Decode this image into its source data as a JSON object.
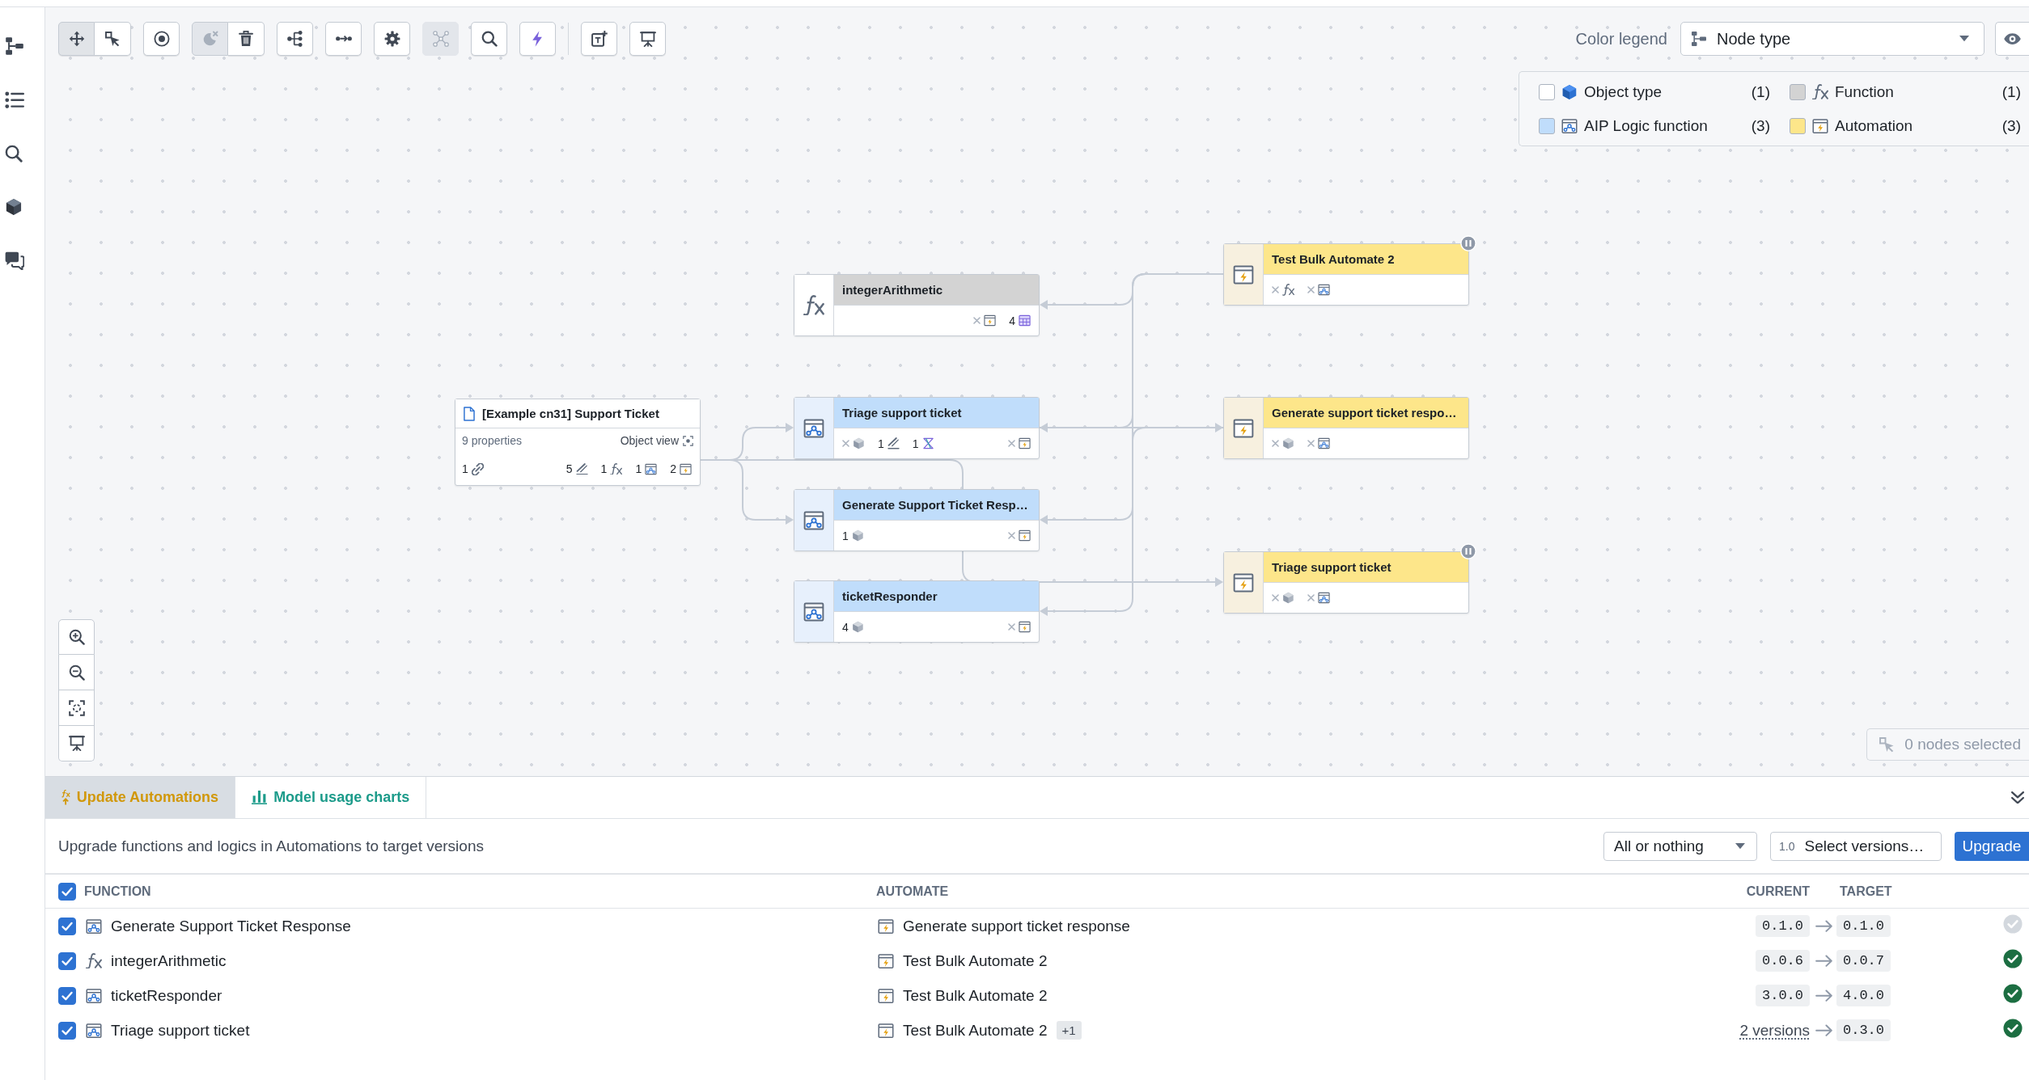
{
  "toolbar": {
    "modes": [
      {
        "kind": "pan",
        "selected": true
      },
      {
        "kind": "select",
        "selected": false
      }
    ],
    "actions": [
      [
        {
          "kind": "focus",
          "disabled": false
        }
      ],
      [
        {
          "kind": "hide",
          "disabled": true
        },
        {
          "kind": "delete",
          "disabled": false
        }
      ],
      [
        {
          "kind": "layout",
          "disabled": false
        }
      ],
      [
        {
          "kind": "path",
          "disabled": false
        }
      ],
      [
        {
          "kind": "settings",
          "disabled": false
        }
      ],
      [
        {
          "kind": "cluster",
          "disabled": true
        }
      ],
      [
        {
          "kind": "search",
          "disabled": false
        }
      ],
      [
        {
          "kind": "automate",
          "disabled": false
        }
      ]
    ],
    "insert": [
      {
        "kind": "text",
        "disabled": false
      },
      {
        "kind": "present",
        "disabled": false
      }
    ]
  },
  "color_legend": {
    "label": "Color legend",
    "value": "Node type",
    "items": [
      {
        "kind": "object",
        "label": "Object type",
        "count": "(1)",
        "color": "#ffffff"
      },
      {
        "kind": "function",
        "label": "Function",
        "count": "(1)",
        "color": "#d3d3d3"
      },
      {
        "kind": "logic",
        "label": "AIP Logic function",
        "count": "(3)",
        "color": "#c0ddfb"
      },
      {
        "kind": "automation",
        "label": "Automation",
        "count": "(3)",
        "color": "#fde68a"
      }
    ]
  },
  "graph": {
    "object_types": [
      {
        "title": "[Example cn31] Support Ticket",
        "subtitle": "9 properties",
        "action": "Object view",
        "start": [
          {
            "kind": "link",
            "count": "1"
          }
        ],
        "end": [
          {
            "kind": "property",
            "count": "5"
          },
          {
            "kind": "function",
            "count": "1"
          },
          {
            "kind": "logic",
            "count": "1"
          },
          {
            "kind": "automation",
            "count": "2"
          }
        ]
      }
    ],
    "functions": [
      {
        "kind": "function",
        "title": "integerArithmetic",
        "end": [
          {
            "kind": "automation"
          },
          {
            "kind": "module",
            "count": "4"
          }
        ]
      },
      {
        "kind": "logic",
        "title": "Triage support ticket",
        "start": [
          {
            "kind": "object"
          },
          {
            "kind": "property",
            "count": "1"
          },
          {
            "kind": "model",
            "count": "1"
          }
        ],
        "end": [
          {
            "kind": "automation"
          }
        ]
      },
      {
        "kind": "logic",
        "title": "Generate Support Ticket Resp…",
        "start": [
          {
            "kind": "object",
            "count": "1"
          }
        ],
        "end": [
          {
            "kind": "automation"
          }
        ]
      },
      {
        "kind": "logic",
        "title": "ticketResponder",
        "start": [
          {
            "kind": "object",
            "count": "4"
          }
        ],
        "end": [
          {
            "kind": "automation"
          }
        ]
      }
    ],
    "automations": [
      {
        "title": "Test Bulk Automate 2",
        "paused": true,
        "start": [
          {
            "kind": "function"
          },
          {
            "kind": "logic"
          }
        ]
      },
      {
        "title": "Generate support ticket respo…",
        "paused": false,
        "start": [
          {
            "kind": "object"
          },
          {
            "kind": "logic"
          }
        ]
      },
      {
        "title": "Triage support ticket",
        "paused": true,
        "start": [
          {
            "kind": "object"
          },
          {
            "kind": "logic"
          }
        ]
      }
    ]
  },
  "selection_status": "0 nodes selected",
  "bottom_panel": {
    "tabs": [
      {
        "kind": "upgrade",
        "label": "Update Automations",
        "selected": true
      },
      {
        "kind": "charts",
        "label": "Model usage charts",
        "selected": false
      }
    ],
    "description": "Upgrade functions and logics in Automations to target versions",
    "mode_select": "All or nothing",
    "versions_button": {
      "prefix": "1.0",
      "label": "Select versions…"
    },
    "upgrade_button": "Upgrade",
    "table": {
      "columns": [
        "FUNCTION",
        "AUTOMATE",
        "CURRENT",
        "TARGET"
      ],
      "all_checked": true,
      "rows": [
        {
          "checked": true,
          "kind": "logic",
          "function": "Generate Support Ticket Response",
          "automate": "Generate support ticket response",
          "current": {
            "kind": "version",
            "text": "0.1.0"
          },
          "target": "0.1.0",
          "upgradable": false
        },
        {
          "checked": true,
          "kind": "function",
          "function": "integerArithmetic",
          "automate": "Test Bulk Automate 2",
          "current": {
            "kind": "version",
            "text": "0.0.6"
          },
          "target": "0.0.7",
          "upgradable": true
        },
        {
          "checked": true,
          "kind": "logic",
          "function": "ticketResponder",
          "automate": "Test Bulk Automate 2",
          "current": {
            "kind": "version",
            "text": "3.0.0"
          },
          "target": "4.0.0",
          "upgradable": true
        },
        {
          "checked": true,
          "kind": "logic",
          "function": "Triage support ticket",
          "automate": "Test Bulk Automate 2",
          "extra": "+1",
          "current": {
            "kind": "link",
            "text": "2 versions"
          },
          "target": "0.3.0",
          "upgradable": true
        }
      ]
    }
  }
}
